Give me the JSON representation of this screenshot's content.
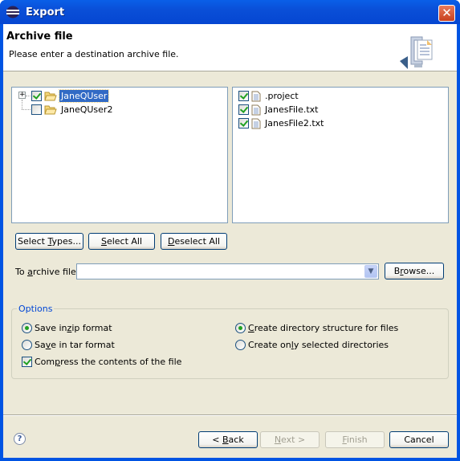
{
  "window": {
    "title": "Export",
    "close_label": "✕"
  },
  "header": {
    "title": "Archive file",
    "description": "Please enter a destination archive file."
  },
  "left_tree": {
    "items": [
      {
        "label": "JaneQUser",
        "checked": true,
        "selected": true,
        "expandable": true
      },
      {
        "label": "JaneQUser2",
        "checked": false,
        "selected": false,
        "expandable": false
      }
    ]
  },
  "right_list": {
    "items": [
      {
        "label": ".project",
        "checked": true
      },
      {
        "label": "JanesFile.txt",
        "checked": true
      },
      {
        "label": "JanesFile2.txt",
        "checked": true
      }
    ]
  },
  "selection_buttons": {
    "select_types": {
      "pre": "Select ",
      "u": "T",
      "post": "ypes..."
    },
    "select_all": {
      "pre": "",
      "u": "S",
      "post": "elect All"
    },
    "deselect_all": {
      "pre": "",
      "u": "D",
      "post": "eselect All"
    }
  },
  "archive": {
    "label": {
      "pre": "To ",
      "u": "a",
      "post": "rchive file:"
    },
    "value": "",
    "browse": {
      "pre": "B",
      "u": "r",
      "post": "owse..."
    }
  },
  "options": {
    "title": "Options",
    "zip": {
      "pre": "Save in ",
      "u": "z",
      "post": "ip format",
      "selected": true
    },
    "tar": {
      "pre": "Sa",
      "u": "v",
      "post": "e in tar format",
      "selected": false
    },
    "compress": {
      "pre": "Com",
      "u": "p",
      "post": "ress the contents of the file",
      "checked": true
    },
    "dir_structure": {
      "pre": "",
      "u": "C",
      "post": "reate directory structure for files",
      "selected": true
    },
    "only_selected": {
      "pre": "Create on",
      "u": "l",
      "post": "y selected directories",
      "selected": false
    }
  },
  "footer": {
    "help": "?",
    "back": {
      "pre": "< ",
      "u": "B",
      "post": "ack",
      "enabled": true
    },
    "next": {
      "pre": "",
      "u": "N",
      "post": "ext >",
      "enabled": false
    },
    "finish": {
      "pre": "",
      "u": "F",
      "post": "inish",
      "enabled": false
    },
    "cancel": {
      "pre": "Cancel",
      "u": "",
      "post": "",
      "enabled": true
    }
  }
}
